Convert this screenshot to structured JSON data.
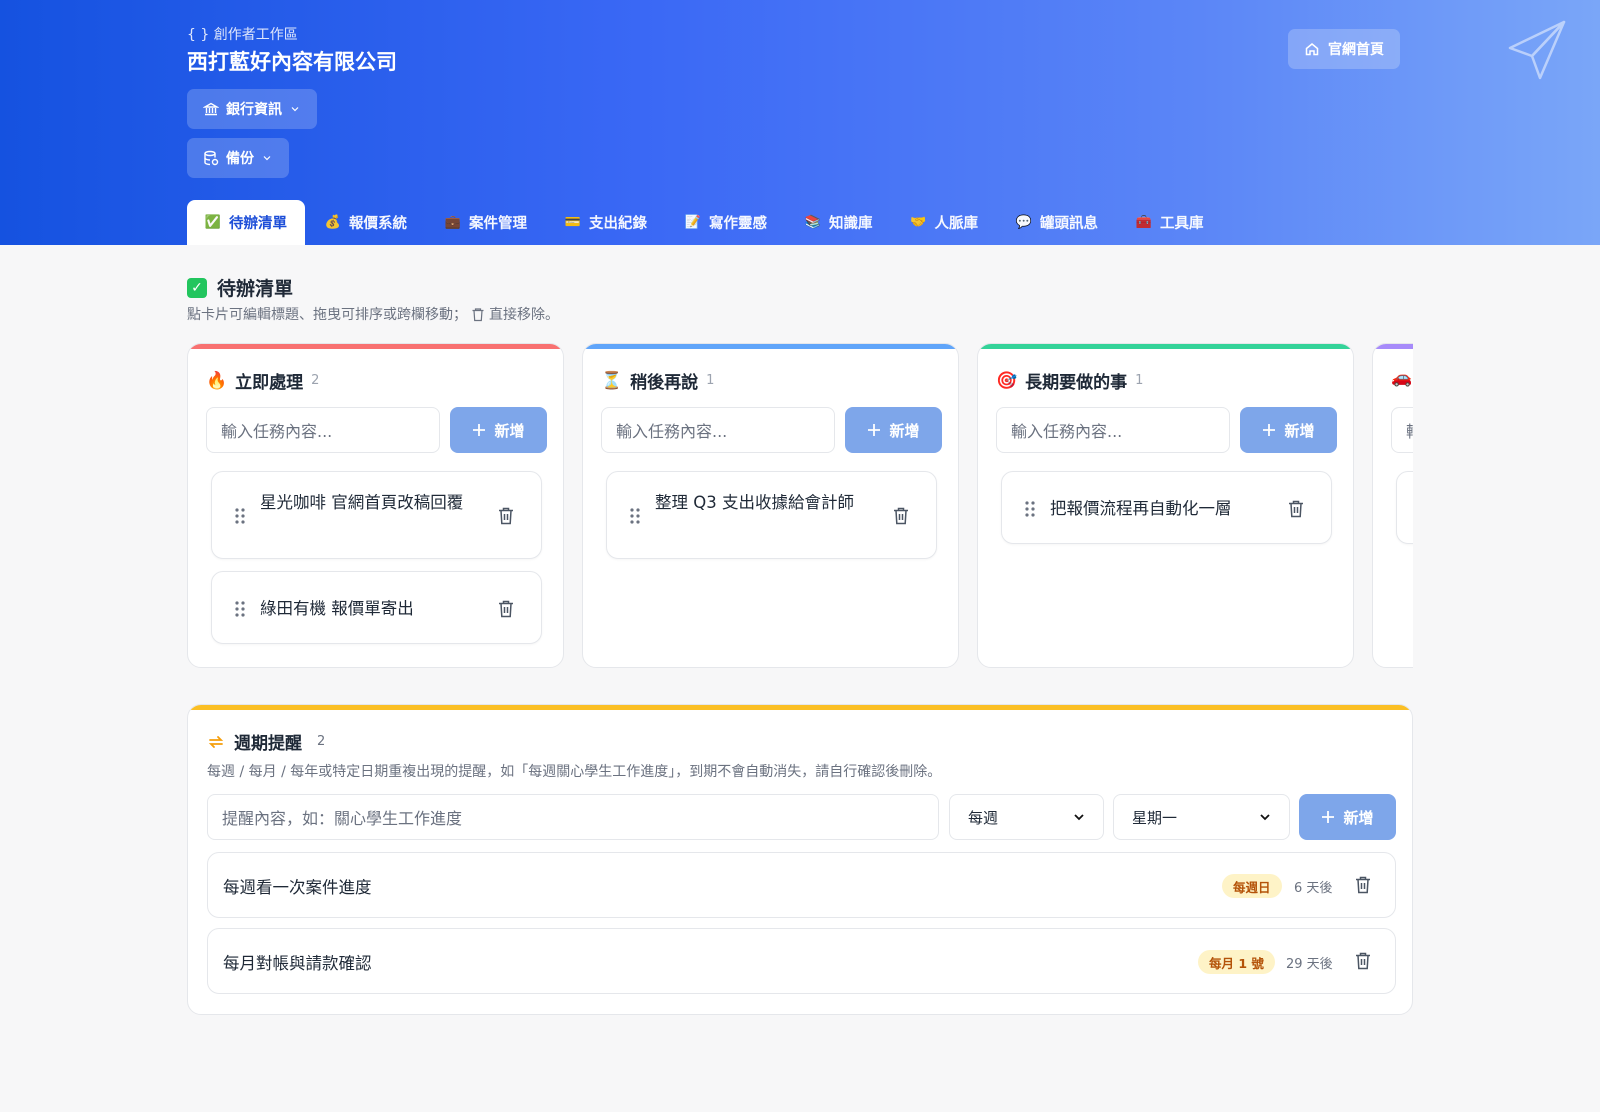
{
  "header": {
    "brand_sub": "{ } 創作者工作區",
    "brand_title": "西打藍好內容有限公司",
    "bank_label": "銀行資訊",
    "backup_label": "備份",
    "home_label": "官網首頁",
    "tabs": [
      {
        "icon": "✅",
        "label": "待辦清單",
        "active": true
      },
      {
        "icon": "💰",
        "label": "報價系統"
      },
      {
        "icon": "💼",
        "label": "案件管理"
      },
      {
        "icon": "💳",
        "label": "支出紀錄"
      },
      {
        "icon": "📝",
        "label": "寫作靈感"
      },
      {
        "icon": "📚",
        "label": "知識庫"
      },
      {
        "icon": "🤝",
        "label": "人脈庫"
      },
      {
        "icon": "💬",
        "label": "罐頭訊息"
      },
      {
        "icon": "🧰",
        "label": "工具庫"
      }
    ]
  },
  "todo": {
    "title": "待辦清單",
    "desc_before": "點卡片可編輯標題、拖曳可排序或跨欄移動；",
    "desc_after": "直接移除。",
    "columns": [
      {
        "icon": "🔥",
        "title": "立即處理",
        "count": "2",
        "color": "#f87171",
        "placeholder": "輸入任務內容...",
        "add_label": "新增",
        "cards": [
          "星光咖啡 官網首頁改稿回覆",
          "綠田有機 報價單寄出"
        ]
      },
      {
        "icon": "⏳",
        "title": "稍後再說",
        "count": "1",
        "color": "#60a5fa",
        "placeholder": "輸入任務內容...",
        "add_label": "新增",
        "cards": [
          "整理 Q3 支出收據給會計師"
        ]
      },
      {
        "icon": "🎯",
        "title": "長期要做的事",
        "count": "1",
        "color": "#34d399",
        "placeholder": "輸入任務內容...",
        "add_label": "新增",
        "cards": [
          "把報價流程再自動化一層"
        ]
      },
      {
        "icon": "🚗",
        "title": "",
        "count": "",
        "color": "#a78bfa",
        "placeholder": "輸",
        "add_label": "",
        "cards": []
      }
    ]
  },
  "weekly": {
    "title": "週期提醒",
    "count": "2",
    "desc": "每週 / 每月 / 每年或特定日期重複出現的提醒，如「每週關心學生工作進度」，到期不會自動消失，請自行確認後刪除。",
    "placeholder": "提醒內容，如：關心學生工作進度",
    "freq_value": "每週",
    "day_value": "星期一",
    "add_label": "新增",
    "items": [
      {
        "text": "每週看一次案件進度",
        "badge": "每週日",
        "due": "6 天後"
      },
      {
        "text": "每月對帳與請款確認",
        "badge": "每月 1 號",
        "due": "29 天後"
      }
    ]
  }
}
